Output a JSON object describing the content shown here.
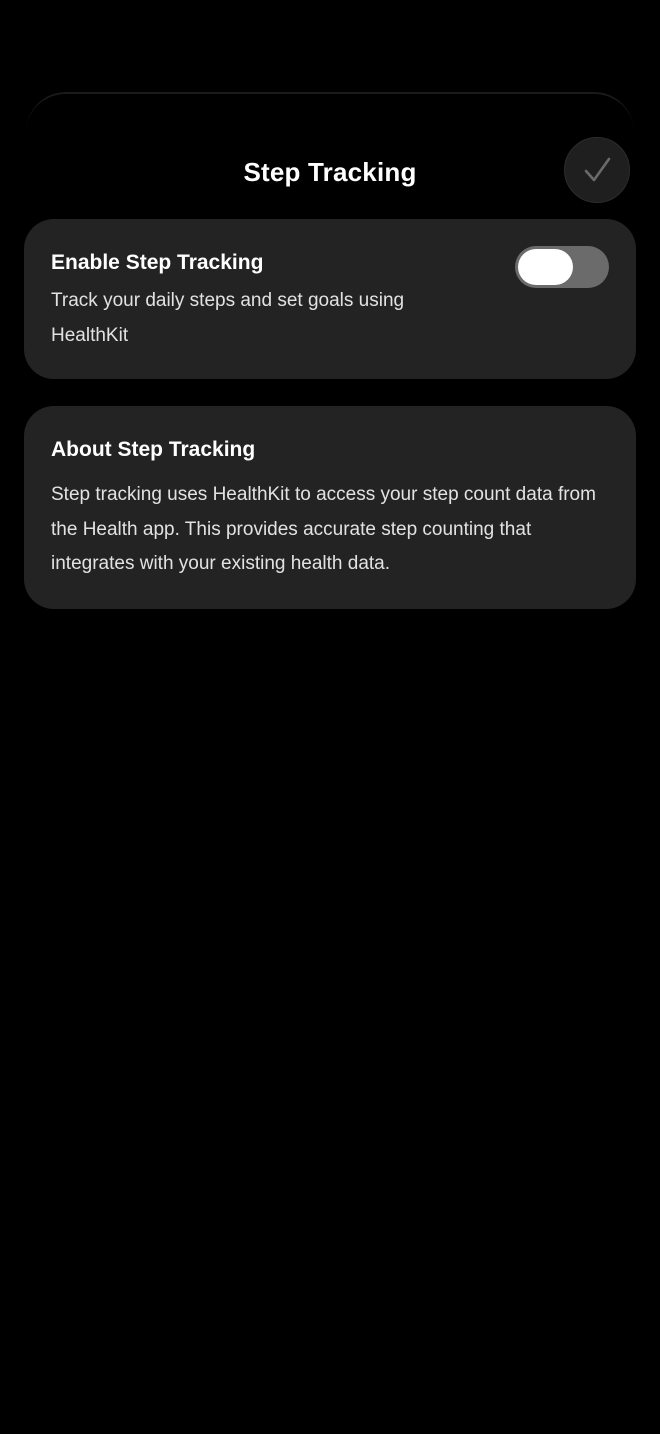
{
  "header": {
    "title": "Step Tracking",
    "done_icon": "checkmark-icon"
  },
  "step_tracking_card": {
    "title": "Enable Step Tracking",
    "description": "Track your daily steps and set goals using HealthKit",
    "toggle_state": "off"
  },
  "about_card": {
    "title": "About Step Tracking",
    "description": "Step tracking uses HealthKit to access your step count data from the Health app. This provides accurate step counting that integrates with your existing health data."
  },
  "colors": {
    "background": "#000000",
    "card": "#232323",
    "toggle_track": "#6b6b6b",
    "toggle_knob": "#ffffff",
    "text_primary": "#ffffff",
    "text_secondary": "#e2e2e2"
  }
}
